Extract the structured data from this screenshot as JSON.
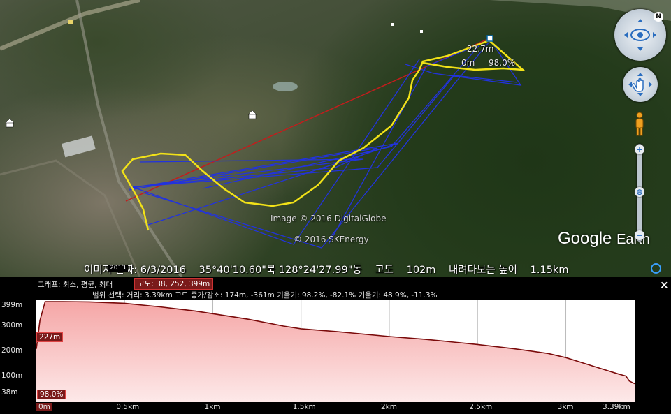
{
  "map": {
    "marker_labels": [
      "22.7m",
      "0m",
      "98.0%"
    ],
    "attribution": [
      "Image © 2016 DigitalGlobe",
      "© 2016 SKEnergy"
    ],
    "logo": {
      "google": "Google",
      "earth": "Earth"
    },
    "status": {
      "imagery_date": "이미지 날짜: 6/3/2016",
      "imagery_year": "2013",
      "coords": "35°40'10.60\"북 128°24'27.99\"동",
      "elevation_label": "고도",
      "elevation": "102m",
      "eye_alt_label": "내려다보는 높이",
      "eye_alt": "1.15km"
    }
  },
  "nav": {
    "north": "N",
    "zoom_in": "+",
    "zoom_out": "−"
  },
  "profile": {
    "graph_info": "그래프: 최소, 평균, 최대",
    "altitude_box": "고도: 38, 252, 399m",
    "range_info": "범위 선택: 거리: 3.39km 고도 증가/감소: 174m, -361m 기울기: 98.2%, -82.1% 기울기: 48.9%, -11.3%",
    "close": "×",
    "y_ticks": [
      "399m",
      "300m",
      "200m",
      "100m",
      "38m"
    ],
    "x_ticks": [
      "0m",
      "0.5km",
      "1km",
      "1.5km",
      "2km",
      "2.5km",
      "3km",
      "3.39km"
    ],
    "cursor_elevation": "227m",
    "cursor_slope": "98.0%"
  },
  "chart_data": {
    "type": "area",
    "xlabel": "",
    "ylabel": "",
    "x": [
      0,
      0.02,
      0.05,
      0.15,
      0.3,
      0.5,
      0.7,
      0.9,
      1.0,
      1.2,
      1.4,
      1.5,
      1.7,
      2.0,
      2.2,
      2.5,
      2.7,
      2.9,
      3.0,
      3.1,
      3.2,
      3.3,
      3.34,
      3.36,
      3.39
    ],
    "y": [
      227,
      330,
      399,
      399,
      398,
      393,
      380,
      365,
      355,
      335,
      310,
      300,
      290,
      272,
      262,
      243,
      228,
      210,
      195,
      175,
      155,
      135,
      128,
      110,
      100
    ],
    "ylim": [
      38,
      399
    ],
    "xlim": [
      0,
      3.39
    ],
    "grid": true,
    "colors": {
      "line": "#7a0a0a",
      "fill_top": "#f5a6a6",
      "fill_bottom": "#fde9e9"
    }
  }
}
